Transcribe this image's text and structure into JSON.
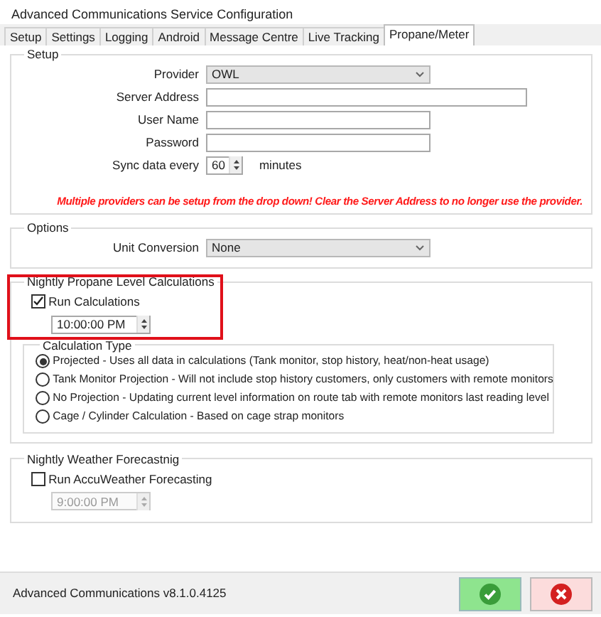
{
  "window": {
    "title": "Advanced Communications Service Configuration"
  },
  "tabs": [
    {
      "label": "Setup",
      "selected": false
    },
    {
      "label": "Settings",
      "selected": false
    },
    {
      "label": "Logging",
      "selected": false
    },
    {
      "label": "Android",
      "selected": false
    },
    {
      "label": "Message Centre",
      "selected": false
    },
    {
      "label": "Live Tracking",
      "selected": false
    },
    {
      "label": "Propane/Meter",
      "selected": true
    }
  ],
  "setup": {
    "title": "Setup",
    "fields": [
      {
        "kind": "select",
        "label": "Provider",
        "value": "OWL"
      },
      {
        "kind": "longtext",
        "label": "Server Address"
      },
      {
        "kind": "text",
        "label": "User Name"
      },
      {
        "kind": "password",
        "label": "Password"
      },
      {
        "kind": "spin",
        "label": "Sync data every",
        "value": "60",
        "unit": "minutes"
      }
    ],
    "notice": "Multiple providers can be setup from the drop down! Clear the Server Address to no longer use the provider."
  },
  "options": {
    "title": "Options",
    "fields": [
      {
        "kind": "select",
        "label": "Unit Conversion",
        "value": "None"
      }
    ]
  },
  "propane": {
    "title": "Nightly Propane Level Calculations",
    "highlighted": true,
    "run": {
      "label": "Run Calculations",
      "checked": true
    },
    "time": {
      "value": "10:00:00 PM",
      "disabled": false
    },
    "calculation_type": {
      "title": "Calculation Type",
      "options": [
        {
          "label": "Projected - Uses all data in calculations (Tank monitor, stop history, heat/non-heat usage)",
          "selected": true
        },
        {
          "label": "Tank Monitor Projection -  Will not include stop history customers, only customers with remote monitors",
          "selected": false
        },
        {
          "label": "No Projection - Updating current level information on route tab with remote monitors last reading level",
          "selected": false
        },
        {
          "label": "Cage / Cylinder Calculation - Based on cage strap monitors",
          "selected": false
        }
      ]
    }
  },
  "weather": {
    "title": "Nightly Weather Forecastnig",
    "run": {
      "label": "Run AccuWeather Forecasting",
      "checked": false
    },
    "time": {
      "value": "9:00:00 PM",
      "disabled": true
    }
  },
  "status_bar": {
    "version": "Advanced Communications v8.1.0.4125"
  },
  "buttons": [
    {
      "kind": "ok"
    },
    {
      "kind": "cancel"
    }
  ]
}
